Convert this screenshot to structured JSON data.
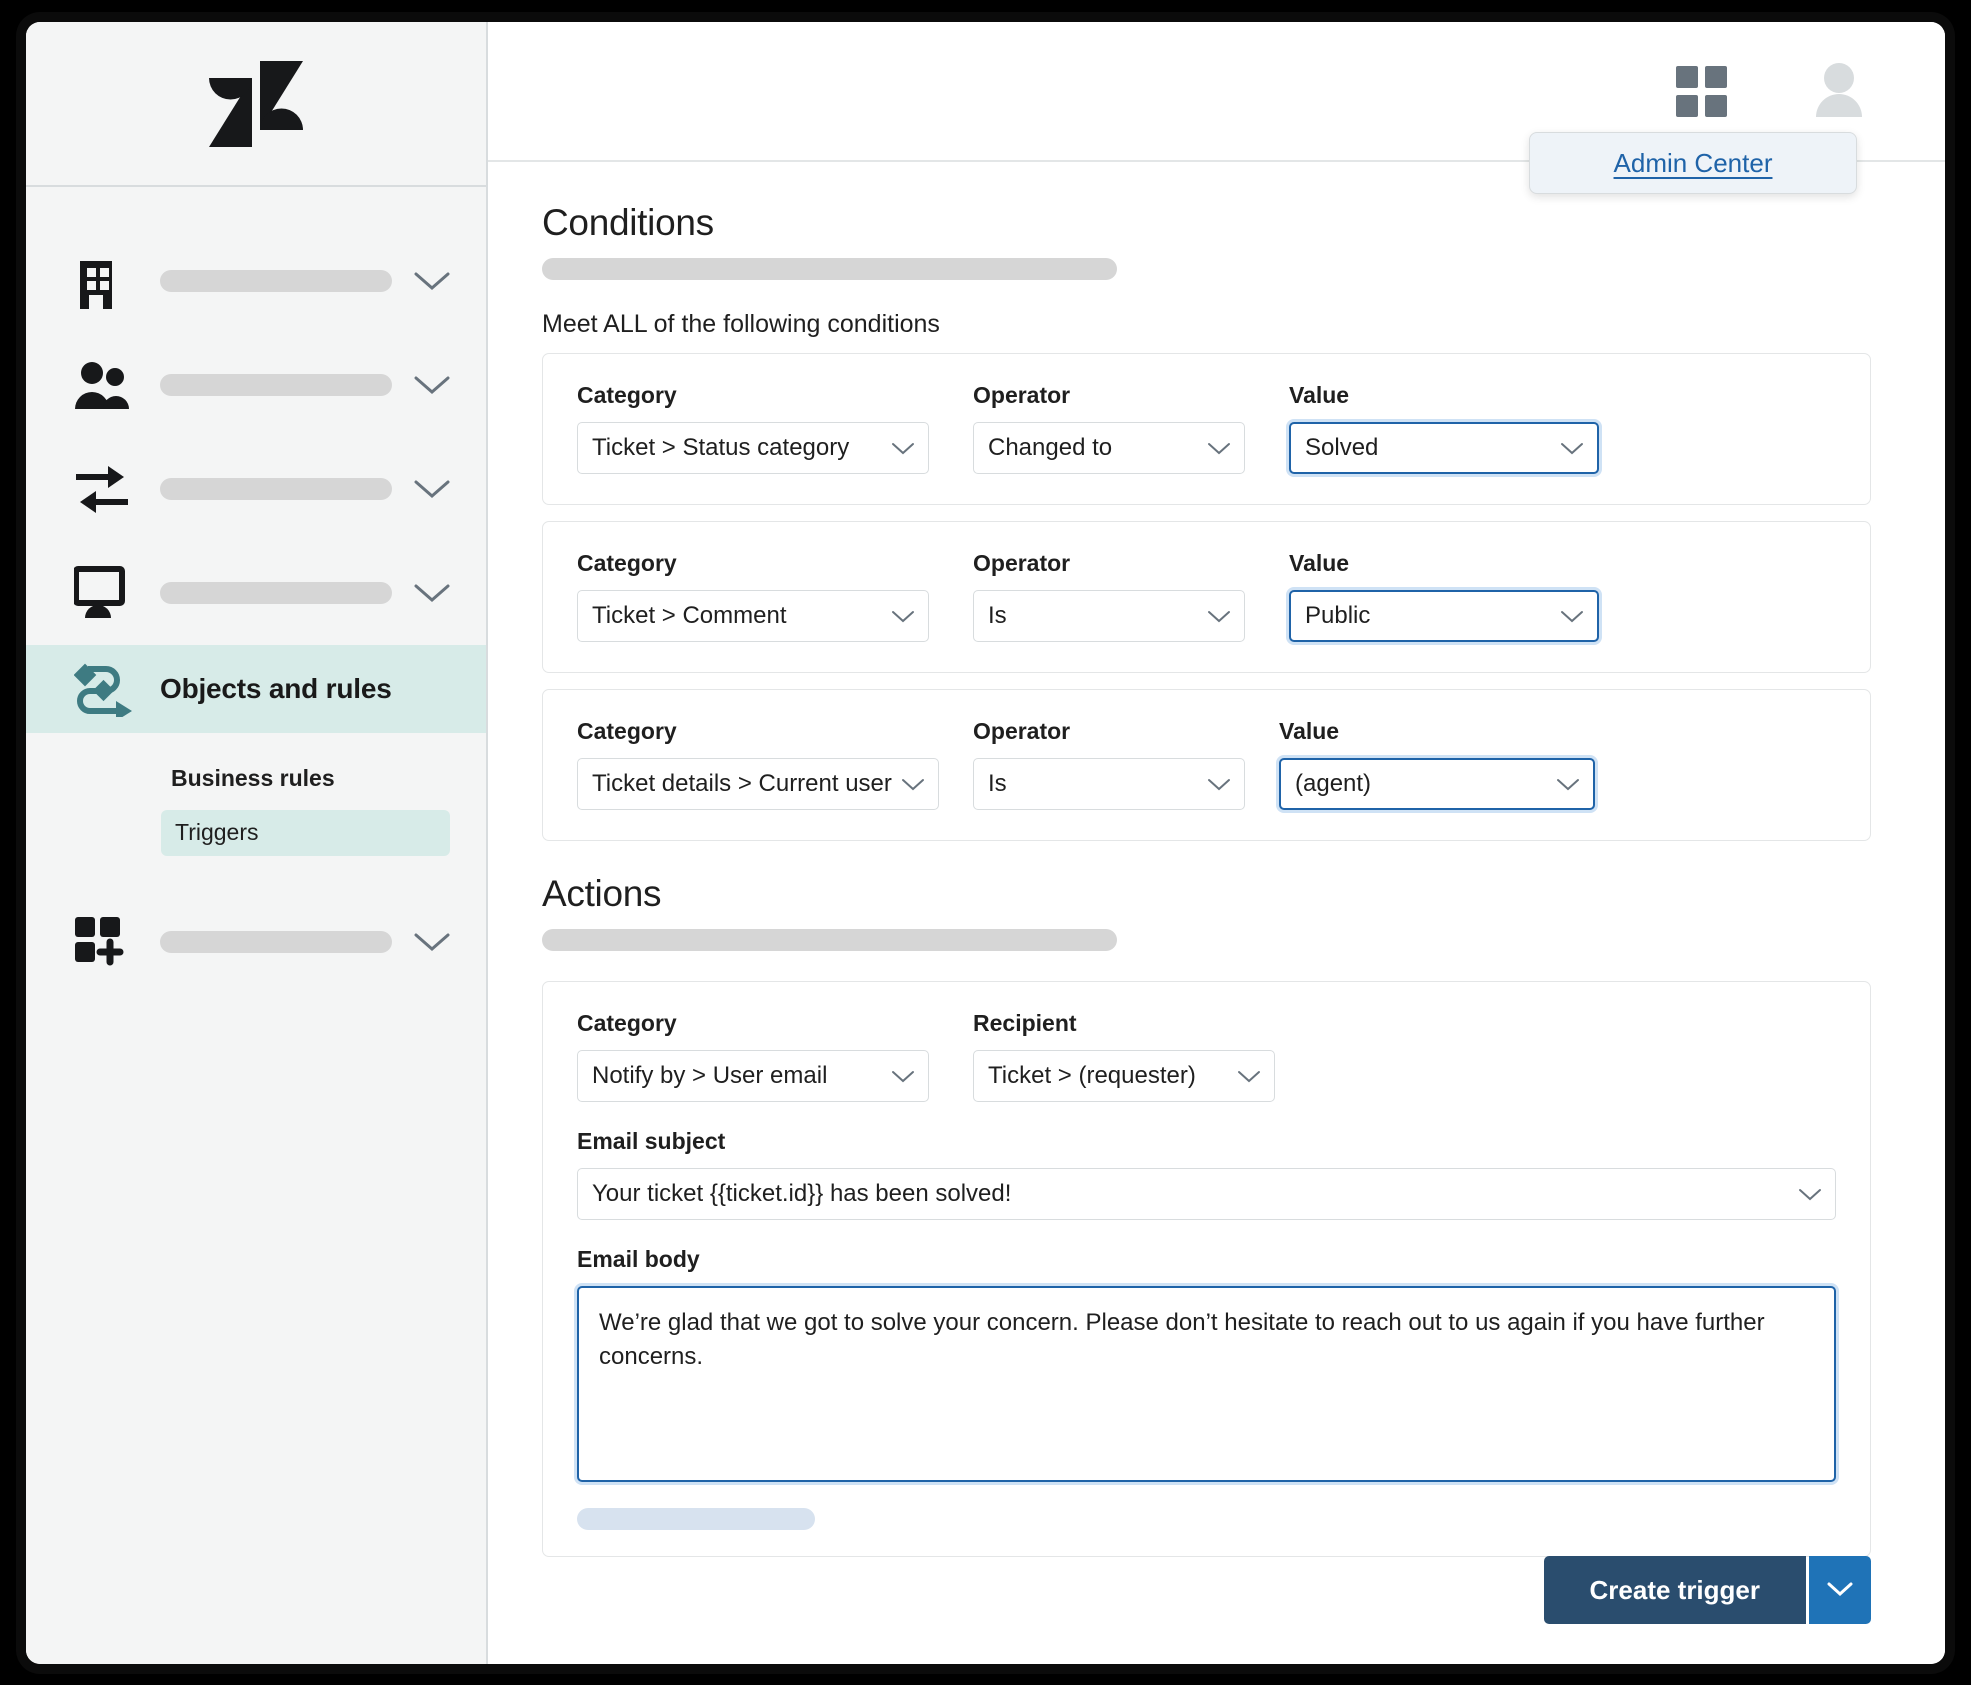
{
  "colors": {
    "sidebar_bg": "#f4f5f5",
    "active_nav": "#d7ebe8",
    "accent_teal": "#3e7b82",
    "focus_blue": "#1f63a8",
    "primary_button": "#2a4d6e",
    "split_button": "#1f73b7",
    "skeleton_gray": "#d6d6d6",
    "skeleton_blue": "#d7e2ef"
  },
  "sidebar": {
    "logo": "zendesk-logo",
    "items": [
      {
        "icon": "building-icon",
        "label": "",
        "placeholder": true,
        "expandable": true
      },
      {
        "icon": "people-icon",
        "label": "",
        "placeholder": true,
        "expandable": true
      },
      {
        "icon": "arrows-exchange-icon",
        "label": "",
        "placeholder": true,
        "expandable": true
      },
      {
        "icon": "monitor-icon",
        "label": "",
        "placeholder": true,
        "expandable": true
      },
      {
        "icon": "objects-rules-icon",
        "label": "Objects and rules",
        "placeholder": false,
        "expandable": false,
        "active": true
      },
      {
        "icon": "apps-add-icon",
        "label": "",
        "placeholder": true,
        "expandable": true
      }
    ],
    "subsection": {
      "heading": "Business rules",
      "items": [
        {
          "label": "Triggers",
          "selected": true
        }
      ]
    }
  },
  "topbar": {
    "grid_icon": "grid-apps-icon",
    "avatar_icon": "user-avatar-icon"
  },
  "admin_popup": {
    "link_label": "Admin Center"
  },
  "conditions": {
    "title": "Conditions",
    "subtitle": "Meet ALL of the following conditions",
    "labels": {
      "category": "Category",
      "operator": "Operator",
      "value": "Value"
    },
    "rows": [
      {
        "category": "Ticket > Status category",
        "operator": "Changed to",
        "value": "Solved",
        "value_focused": true
      },
      {
        "category": "Ticket > Comment",
        "operator": "Is",
        "value": "Public",
        "value_focused": true
      },
      {
        "category": "Ticket details > Current user",
        "operator": "Is",
        "value": "(agent)",
        "value_focused": true
      }
    ]
  },
  "actions": {
    "title": "Actions",
    "labels": {
      "category": "Category",
      "recipient": "Recipient",
      "email_subject": "Email subject",
      "email_body": "Email body"
    },
    "category": "Notify by > User email",
    "recipient": "Ticket > (requester)",
    "email_subject": "Your ticket {{ticket.id}} has been solved!",
    "email_body": "We’re glad that we got to solve your concern. Please don’t hesitate to reach out to us again if you have further concerns."
  },
  "footer": {
    "create_label": "Create trigger",
    "split_icon": "chevron-down-icon"
  }
}
